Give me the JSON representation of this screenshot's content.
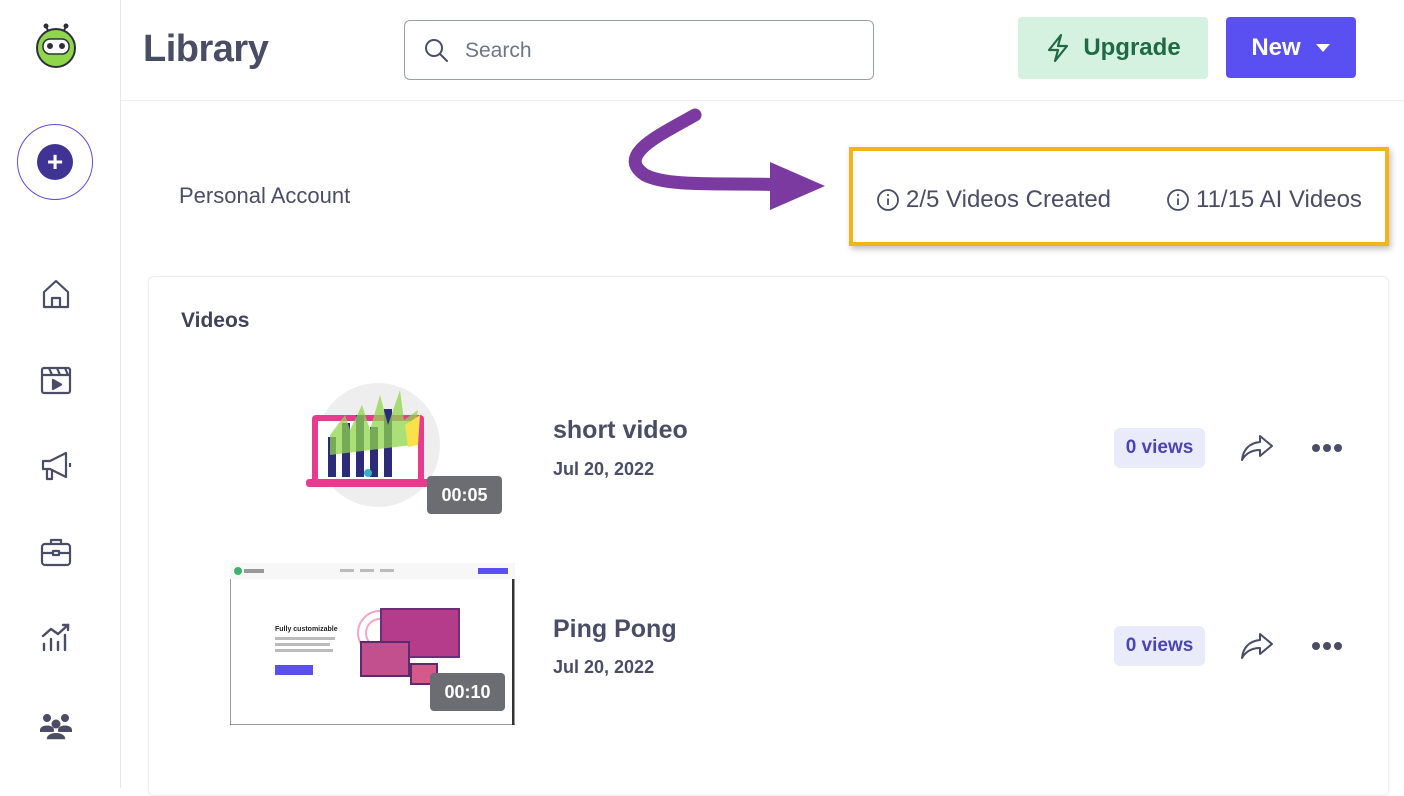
{
  "header": {
    "title": "Library",
    "search_placeholder": "Search",
    "upgrade_label": "Upgrade",
    "new_label": "New"
  },
  "sidebar": {
    "items": [
      {
        "name": "home-icon"
      },
      {
        "name": "video-library-icon"
      },
      {
        "name": "megaphone-icon"
      },
      {
        "name": "briefcase-icon"
      },
      {
        "name": "analytics-icon"
      },
      {
        "name": "team-icon"
      }
    ]
  },
  "account": {
    "name": "Personal Account",
    "videos_created": "2/5 Videos Created",
    "ai_videos": "11/15 AI Videos"
  },
  "videos": {
    "section_title": "Videos",
    "items": [
      {
        "title": "short video",
        "date": "Jul 20, 2022",
        "duration": "00:05",
        "views": "0 views"
      },
      {
        "title": "Ping Pong",
        "date": "Jul 20, 2022",
        "duration": "00:10",
        "views": "0 views"
      }
    ]
  },
  "thumbnails": {
    "ping_pong_heading": "Fully customizable"
  },
  "colors": {
    "accent": "#5a4ff0",
    "upgrade_bg": "#d5f2e1",
    "highlight": "#f3b31b",
    "arrow": "#7a3aa0"
  }
}
